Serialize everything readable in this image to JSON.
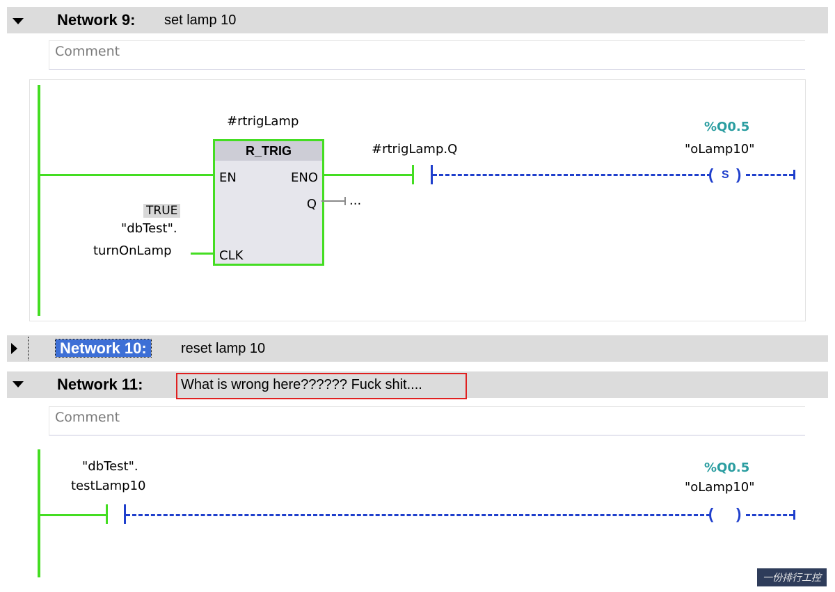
{
  "networks": [
    {
      "title": "Network 9:",
      "description": "set lamp 10",
      "comment": "Comment",
      "expanded": true
    },
    {
      "title": "Network 10:",
      "description": "reset lamp 10",
      "expanded": false,
      "selected": true
    },
    {
      "title": "Network 11:",
      "description": "What is wrong here?????? Fuck shit....",
      "comment": "Comment",
      "expanded": true
    }
  ],
  "net9": {
    "instance": "#rtrigLamp",
    "block_type": "R_TRIG",
    "pin_en": "EN",
    "pin_eno": "ENO",
    "pin_q": "Q",
    "pin_clk": "CLK",
    "q_output": "...",
    "clk_value": "TRUE",
    "clk_operand_line1": "\"dbTest\".",
    "clk_operand_line2": "turnOnLamp",
    "contact_operand": "#rtrigLamp.Q",
    "coil_address": "%Q0.5",
    "coil_operand": "\"oLamp10\"",
    "coil_type": "S"
  },
  "net11": {
    "contact_operand_line1": "\"dbTest\".",
    "contact_operand_line2": "testLamp10",
    "coil_address": "%Q0.5",
    "coil_operand": "\"oLamp10\""
  },
  "colors": {
    "powered": "#44dd22",
    "unpowered": "#1f3fcc",
    "highlight": "#e02020",
    "selection": "#3d6fd6"
  },
  "watermark": "一份排行工控"
}
